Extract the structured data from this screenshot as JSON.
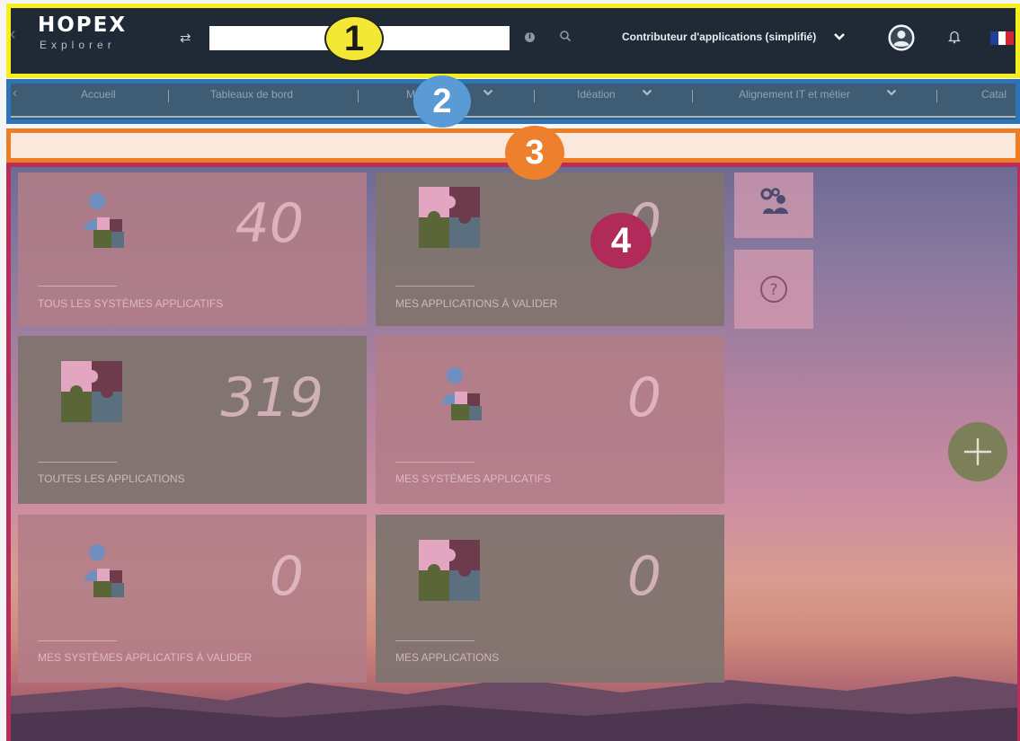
{
  "header": {
    "logo_title": "HOPEX",
    "logo_subtitle": "Explorer",
    "search": {
      "value": "",
      "placeholder": ""
    },
    "role": "Contributeur d'applications (simplifié)",
    "icons": [
      "back-arrow-icon",
      "swap-icon",
      "info-icon",
      "search-icon",
      "chevron-down-icon",
      "user-icon",
      "bell-icon",
      "flag-fr-icon"
    ]
  },
  "nav": {
    "tabs": [
      {
        "label": "Accueil",
        "has_menu": false
      },
      {
        "label": "Tableaux de bord",
        "has_menu": false
      },
      {
        "label": "Mo",
        "has_menu": true
      },
      {
        "label": "Idéation",
        "has_menu": true
      },
      {
        "label": "Alignement IT et métier",
        "has_menu": true
      },
      {
        "label": "Catal",
        "has_menu": false
      }
    ]
  },
  "message_bar": {
    "text": ""
  },
  "dashboard": {
    "tiles": [
      {
        "title": "Tous les systèmes applicatifs",
        "count": "40",
        "icon": "user-puzzle-icon"
      },
      {
        "title": "Mes applications à valider",
        "count": "0",
        "icon": "puzzle-icon"
      },
      {
        "title": "Toutes les applications",
        "count": "319",
        "icon": "puzzle-icon"
      },
      {
        "title": "Mes systèmes applicatifs",
        "count": "0",
        "icon": "user-puzzle-icon"
      },
      {
        "title": "Mes systèmes applicatifs à valider",
        "count": "0",
        "icon": "user-puzzle-icon"
      },
      {
        "title": "Mes applications",
        "count": "0",
        "icon": "puzzle-icon"
      }
    ],
    "side_buttons": [
      "settings-users-icon",
      "help-icon"
    ],
    "fab_icon": "plus-icon"
  },
  "annotations": [
    "1",
    "2",
    "3",
    "4"
  ],
  "colors": {
    "region1_border": "#f7ef1b",
    "region2_border": "#2c73b8",
    "region3_border": "#ef7d24",
    "region4_border": "#b92d5a",
    "topbar_bg": "#1f2a36"
  }
}
